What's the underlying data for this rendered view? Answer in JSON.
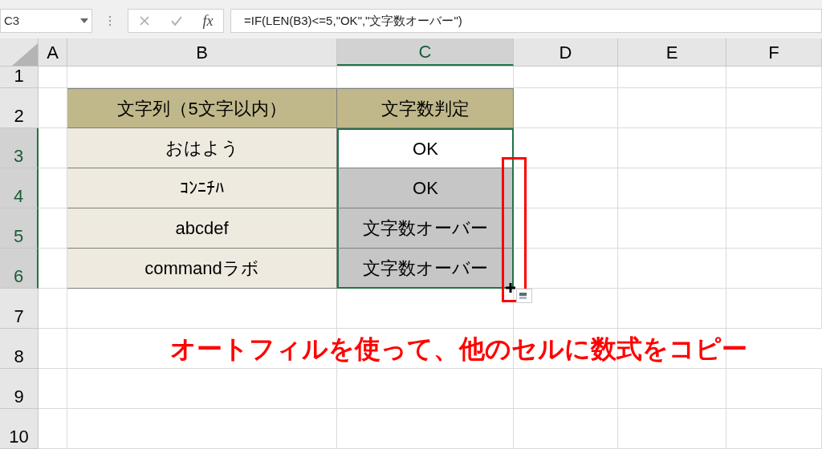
{
  "name_box": "C3",
  "formula_bar": {
    "function_label": "fx",
    "formula": "=IF(LEN(B3)<=5,\"OK\",\"文字数オーバー\")"
  },
  "columns": [
    {
      "label": "A",
      "selected": false
    },
    {
      "label": "B",
      "selected": false
    },
    {
      "label": "C",
      "selected": true
    },
    {
      "label": "D",
      "selected": false
    },
    {
      "label": "E",
      "selected": false
    },
    {
      "label": "F",
      "selected": false
    }
  ],
  "rows": [
    {
      "label": "1",
      "selected": false
    },
    {
      "label": "2",
      "selected": false
    },
    {
      "label": "3",
      "selected": true
    },
    {
      "label": "4",
      "selected": true
    },
    {
      "label": "5",
      "selected": true
    },
    {
      "label": "6",
      "selected": true
    },
    {
      "label": "7",
      "selected": false
    },
    {
      "label": "8",
      "selected": false
    },
    {
      "label": "9",
      "selected": false
    },
    {
      "label": "10",
      "selected": false
    }
  ],
  "table": {
    "header": [
      "文字列（5文字以内）",
      "文字数判定"
    ],
    "rows": [
      {
        "text": "おはよう",
        "result": "OK",
        "selected": true,
        "active": true
      },
      {
        "text": "ｺﾝﾆﾁﾊ",
        "result": "OK",
        "selected": true,
        "active": false
      },
      {
        "text": "abcdef",
        "result": "文字数オーバー",
        "selected": true,
        "active": false
      },
      {
        "text": "commandラボ",
        "result": "文字数オーバー",
        "selected": true,
        "active": false
      }
    ]
  },
  "annotation": "オートフィルを使って、他のセルに数式をコピー"
}
